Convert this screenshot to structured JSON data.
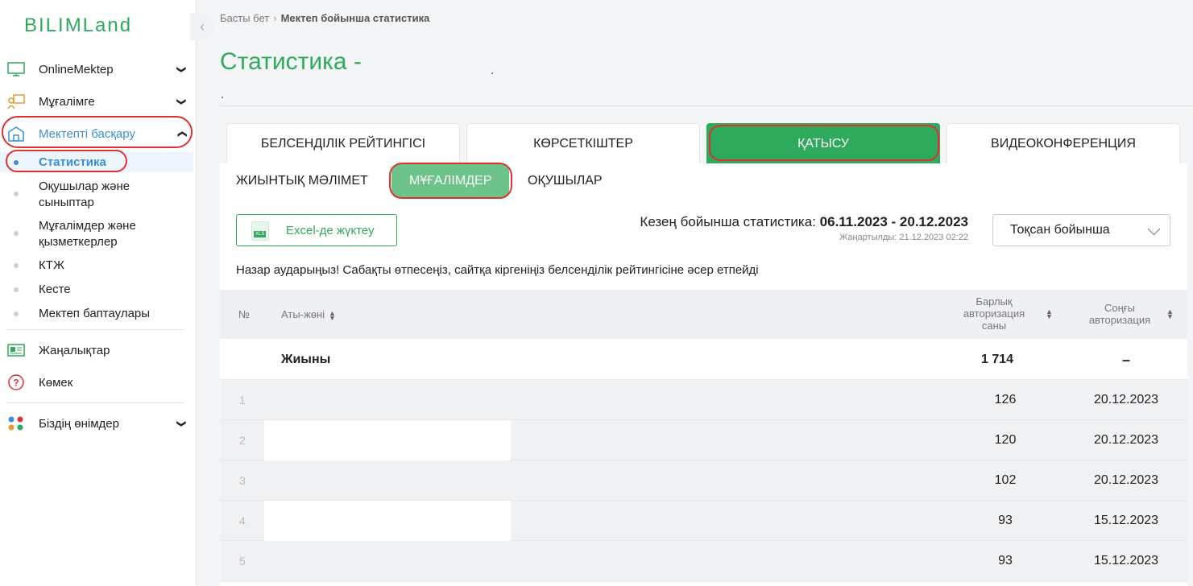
{
  "sidebar": {
    "logo": "BILIMLand",
    "items": [
      {
        "label": "OnlineMektep",
        "icon": "monitor-icon"
      },
      {
        "label": "Мұғалімге",
        "icon": "teacher-icon"
      },
      {
        "label": "Мектепті басқару",
        "icon": "school-icon"
      },
      {
        "label": "Жаңалықтар",
        "icon": "news-icon"
      },
      {
        "label": "Көмек",
        "icon": "help-icon"
      },
      {
        "label": "Біздің өнімдер",
        "icon": "apps-icon"
      }
    ],
    "subitems": [
      "Статистика",
      "Оқушылар және сыныптар",
      "Мұғалімдер және қызметкерлер",
      "КТЖ",
      "Кесте",
      "Мектеп баптаулары"
    ]
  },
  "breadcrumb": {
    "home": "Басты бет",
    "current": "Мектеп бойынша статистика"
  },
  "page_title": "Статистика -",
  "top_tabs": [
    "БЕЛСЕНДІЛІК РЕЙТИНГІСІ",
    "КӨРСЕТКІШТЕР",
    "ҚАТЫСУ",
    "ВИДЕОКОНФЕРЕНЦИЯ"
  ],
  "sub_tabs": [
    "ЖИЫНТЫҚ МӘЛІМЕТ",
    "МҰҒАЛІМДЕР",
    "ОҚУШЫЛАР"
  ],
  "excel_button": "Excel-де жүктеу",
  "xls_badge": "XLS",
  "period_label": "Кезең бойынша статистика:",
  "period_value": "06.11.2023 - 20.12.2023",
  "updated": "Жаңартылды: 21.12.2023 02:22",
  "select_value": "Тоқсан бойынша",
  "notice": "Назар аударыңыз! Сабақты өтпесеңіз, сайтқа кіргеніңіз белсенділік рейтингісіне әсер етпейді",
  "table": {
    "headers": {
      "num": "№",
      "name": "Аты-жөні",
      "total_auth_1": "Барлық",
      "total_auth_2": "авторизация",
      "total_auth_3": "саны",
      "last_auth_1": "Соңғы",
      "last_auth_2": "авторизация"
    },
    "total_label": "Жиыны",
    "total_count": "1 714",
    "total_last": "–",
    "rows": [
      {
        "n": "1",
        "count": "126",
        "last": "20.12.2023"
      },
      {
        "n": "2",
        "count": "120",
        "last": "20.12.2023"
      },
      {
        "n": "3",
        "count": "102",
        "last": "20.12.2023"
      },
      {
        "n": "4",
        "count": "93",
        "last": "15.12.2023"
      },
      {
        "n": "5",
        "count": "93",
        "last": "15.12.2023"
      }
    ]
  },
  "colors": {
    "brand_green": "#2eaa5c",
    "active_blue": "#3a8fd8",
    "highlight_red": "#e03131"
  }
}
